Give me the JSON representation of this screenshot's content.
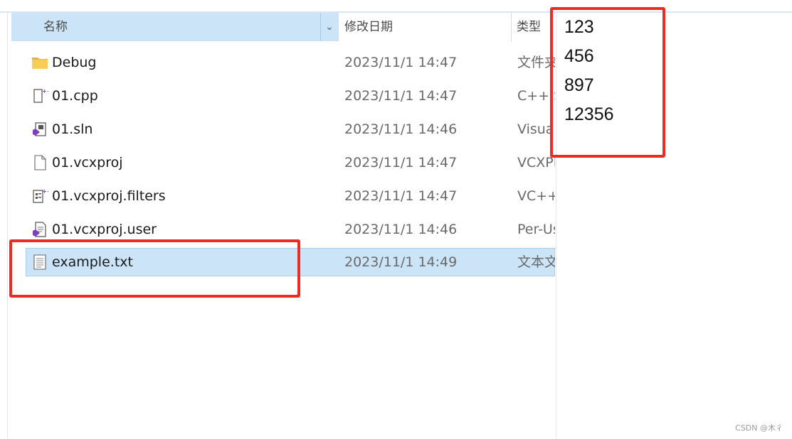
{
  "columns": {
    "name": "名称",
    "date": "修改日期",
    "type": "类型",
    "sort_glyph": "^",
    "dropdown_glyph": "⌄"
  },
  "files": [
    {
      "name": "Debug",
      "date": "2023/11/1 14:47",
      "type": "文件夹",
      "icon": "folder-icon"
    },
    {
      "name": "01.cpp",
      "date": "2023/11/1 14:47",
      "type": "C++ S",
      "icon": "cpp-file-icon"
    },
    {
      "name": "01.sln",
      "date": "2023/11/1 14:46",
      "type": "Visua",
      "icon": "vs-solution-icon"
    },
    {
      "name": "01.vcxproj",
      "date": "2023/11/1 14:47",
      "type": "VCXPF",
      "icon": "blank-file-icon"
    },
    {
      "name": "01.vcxproj.filters",
      "date": "2023/11/1 14:47",
      "type": "VC++",
      "icon": "filters-file-icon"
    },
    {
      "name": "01.vcxproj.user",
      "date": "2023/11/1 14:46",
      "type": "Per-Us",
      "icon": "vs-user-file-icon"
    },
    {
      "name": "example.txt",
      "date": "2023/11/1 14:49",
      "type": "文本文",
      "icon": "text-file-icon",
      "selected": true
    }
  ],
  "text_content": [
    "123",
    "456",
    "897",
    "12356"
  ],
  "watermark": "CSDN @木彳",
  "colors": {
    "selection": "#cce4f7",
    "highlight": "#ee2a24",
    "folder": "#f5c542"
  }
}
